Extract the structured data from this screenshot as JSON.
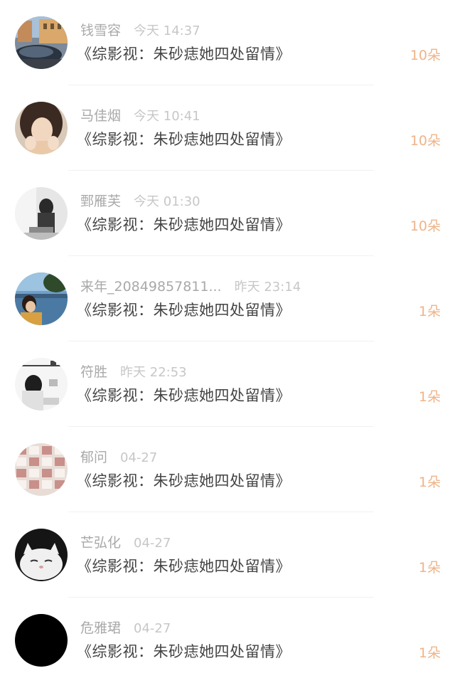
{
  "gifts": [
    {
      "name": "钱雪容",
      "time": "今天 14:37",
      "title": "《综影视：朱砂痣她四处留情》",
      "count": "10朵",
      "avatar_icon": "avatar-city-street-photo"
    },
    {
      "name": "马佳烟",
      "time": "今天 10:41",
      "title": "《综影视：朱砂痣她四处留情》",
      "count": "10朵",
      "avatar_icon": "avatar-girl-portrait"
    },
    {
      "name": "鄄雁芙",
      "time": "今天 01:30",
      "title": "《综影视：朱砂痣她四处留情》",
      "count": "10朵",
      "avatar_icon": "avatar-grayscale-girl"
    },
    {
      "name": "来年_20849857811...",
      "time": "昨天 23:14",
      "title": "《综影视：朱砂痣她四处留情》",
      "count": "1朵",
      "avatar_icon": "avatar-lake-photo"
    },
    {
      "name": "符胜",
      "time": "昨天 22:53",
      "title": "《综影视：朱砂痣她四处留情》",
      "count": "1朵",
      "avatar_icon": "avatar-sketch-girl"
    },
    {
      "name": "郁问",
      "time": "04-27",
      "title": "《综影视：朱砂痣她四处留情》",
      "count": "1朵",
      "avatar_icon": "avatar-pattern-tiles"
    },
    {
      "name": "芒弘化",
      "time": "04-27",
      "title": "《综影视：朱砂痣她四处留情》",
      "count": "1朵",
      "avatar_icon": "avatar-white-cat"
    },
    {
      "name": "危雅珺",
      "time": "04-27",
      "title": "《综影视：朱砂痣她四处留情》",
      "count": "1朵",
      "avatar_icon": "avatar-black-circle"
    }
  ],
  "colors": {
    "name": "#a9a9a9",
    "time": "#c7c7c7",
    "title": "#444444",
    "count": "#efb489",
    "divider": "#f1f1f1"
  }
}
